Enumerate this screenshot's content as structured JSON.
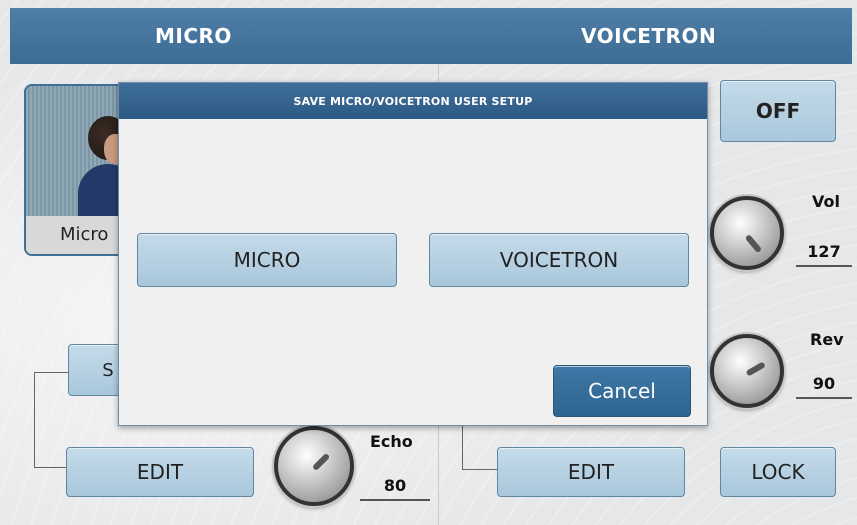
{
  "header": {
    "tab_micro": "MICRO",
    "tab_voicetron": "VOICETRON"
  },
  "micro": {
    "preset_caption": "Micro",
    "side_button_label": "S",
    "edit_label": "EDIT",
    "echo": {
      "label": "Echo",
      "value": "80"
    }
  },
  "voicetron": {
    "off_label": "OFF",
    "vol": {
      "label": "Vol",
      "value": "127"
    },
    "rev": {
      "label": "Rev",
      "value": "90"
    },
    "edit_label": "EDIT",
    "lock_label": "LOCK"
  },
  "dialog": {
    "title": "SAVE MICRO/VOICETRON USER SETUP",
    "micro_label": "MICRO",
    "voicetron_label": "VOICETRON",
    "cancel_label": "Cancel"
  },
  "colors": {
    "header": "#3c6c94",
    "button": "#a9c7db",
    "cancel": "#2e6492"
  },
  "icons": [
    "knob-icon",
    "singer-photo"
  ]
}
